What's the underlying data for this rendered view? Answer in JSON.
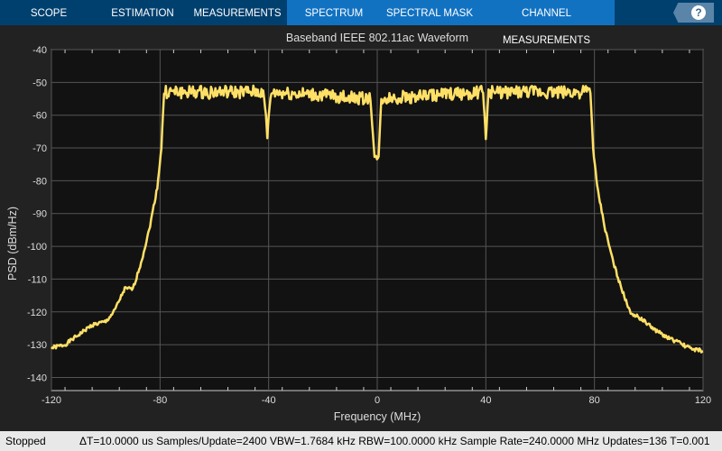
{
  "tabs": [
    {
      "label": "SCOPE"
    },
    {
      "label": "ESTIMATION"
    },
    {
      "label": "MEASUREMENTS"
    },
    {
      "label": "SPECTRUM"
    },
    {
      "label": "SPECTRAL MASK"
    },
    {
      "label": "CHANNEL MEASUREMENTS"
    }
  ],
  "help_label": "?",
  "status": {
    "state": "Stopped",
    "info": "ΔT=10.0000 us  Samples/Update=2400  VBW=1.7684 kHz  RBW=100.0000 kHz  Sample Rate=240.0000 MHz  Updates=136  T=0.001"
  },
  "colors": {
    "trace": "#ffe066",
    "plot_bg": "#121212",
    "grid": "#555555"
  },
  "chart_data": {
    "type": "line",
    "title": "Baseband IEEE 802.11ac Waveform",
    "xlabel": "Frequency (MHz)",
    "ylabel": "PSD (dBm/Hz)",
    "xlim": [
      -120,
      120
    ],
    "ylim": [
      -144,
      -40
    ],
    "xticks": [
      -120,
      -80,
      -40,
      0,
      40,
      80,
      120
    ],
    "yticks": [
      -40,
      -50,
      -60,
      -70,
      -80,
      -90,
      -100,
      -110,
      -120,
      -130,
      -140
    ],
    "grid": true,
    "series": [
      {
        "name": "PSD",
        "x": [
          -120,
          -115,
          -110,
          -105,
          -100,
          -97,
          -93,
          -90,
          -87,
          -84,
          -81,
          -79.5,
          -78.5,
          -42,
          -41,
          -40.5,
          -40,
          -39,
          -2.5,
          -1,
          0.5,
          1.5,
          39,
          39.5,
          40,
          40.5,
          41,
          78.5,
          79.5,
          81,
          84,
          87,
          90,
          93,
          97,
          100,
          105,
          110,
          115,
          120
        ],
        "y": [
          -131,
          -130,
          -127,
          -124,
          -123,
          -120,
          -113,
          -113,
          -105,
          -95,
          -82,
          -70,
          -53,
          -53,
          -60,
          -67,
          -60,
          -53,
          -55,
          -73,
          -73,
          -55,
          -53,
          -60,
          -67,
          -60,
          -53,
          -53,
          -70,
          -82,
          -95,
          -105,
          -113,
          -120,
          -122,
          -124,
          -127,
          -129,
          -131,
          -132
        ]
      }
    ]
  }
}
